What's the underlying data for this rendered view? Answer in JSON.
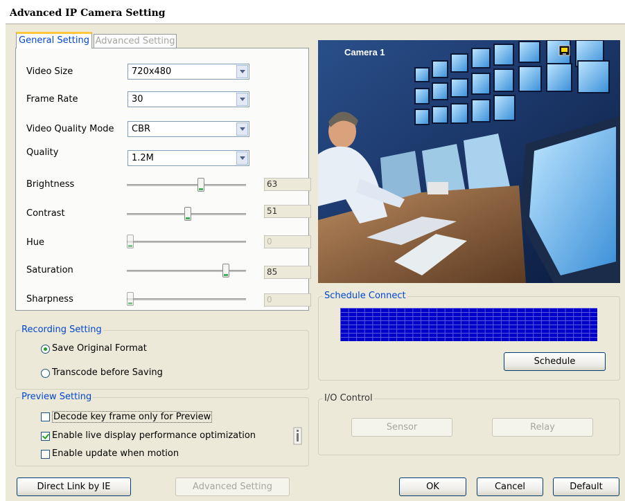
{
  "window": {
    "title": "Advanced IP Camera Setting"
  },
  "tabs": [
    {
      "label": "General Setting",
      "active": true
    },
    {
      "label": "Advanced Setting",
      "active": false
    }
  ],
  "general": {
    "video_size": {
      "label": "Video Size",
      "value": "720x480"
    },
    "frame_rate": {
      "label": "Frame Rate",
      "value": "30"
    },
    "video_quality_mode": {
      "label": "Video Quality Mode",
      "value": "CBR"
    },
    "quality": {
      "label": "Quality",
      "value": "1.2M"
    },
    "sliders": [
      {
        "label": "Brightness",
        "value": "63",
        "level": 0.63,
        "enabled": true
      },
      {
        "label": "Contrast",
        "value": "51",
        "level": 0.51,
        "enabled": true
      },
      {
        "label": "Hue",
        "value": "0",
        "level": 0.0,
        "enabled": false
      },
      {
        "label": "Saturation",
        "value": "85",
        "level": 0.85,
        "enabled": true
      },
      {
        "label": "Sharpness",
        "value": "0",
        "level": 0.0,
        "enabled": false
      }
    ]
  },
  "recording": {
    "title": "Recording Setting",
    "options": [
      {
        "label": "Save Original Format",
        "selected": true
      },
      {
        "label": "Transcode before Saving",
        "selected": false
      }
    ]
  },
  "preview_setting": {
    "title": "Preview Setting",
    "options": [
      {
        "label": "Decode key frame only for Preview",
        "checked": false
      },
      {
        "label": "Enable live display performance optimization",
        "checked": true
      },
      {
        "label": "Enable update when motion",
        "checked": false
      }
    ]
  },
  "camera_preview": {
    "label": "Camera 1",
    "status_icon": "monitor-icon"
  },
  "schedule": {
    "title": "Schedule Connect",
    "button": "Schedule",
    "grid_color": "#0000c8"
  },
  "io": {
    "title": "I/O Control",
    "sensor": "Sensor",
    "relay": "Relay"
  },
  "footer": {
    "direct_link": "Direct Link by IE",
    "advanced_setting": "Advanced Setting",
    "ok": "OK",
    "cancel": "Cancel",
    "default": "Default"
  },
  "colors": {
    "accent": "#0046d5",
    "tab_highlight": "#ffc83c",
    "dialog_bg": "#ece9d8"
  }
}
